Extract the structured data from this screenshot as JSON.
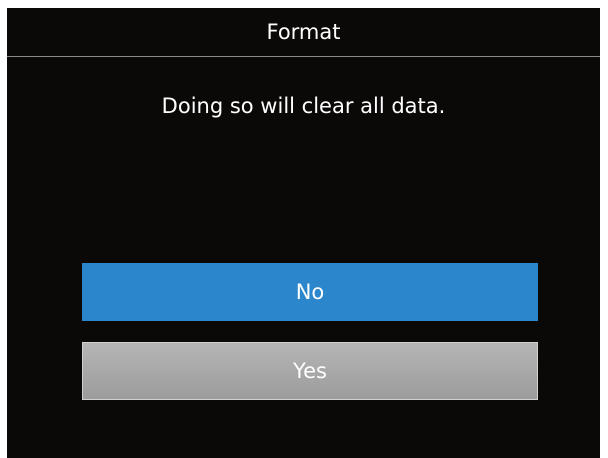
{
  "dialog": {
    "title": "Format",
    "message": "Doing so will clear all data.",
    "options": [
      {
        "label": "No",
        "selected": true
      },
      {
        "label": "Yes",
        "selected": false
      }
    ]
  },
  "colors": {
    "background": "#0b0908",
    "selected_option": "#2b86cc",
    "unselected_option": "#a8a8a8",
    "text": "#ffffff"
  }
}
